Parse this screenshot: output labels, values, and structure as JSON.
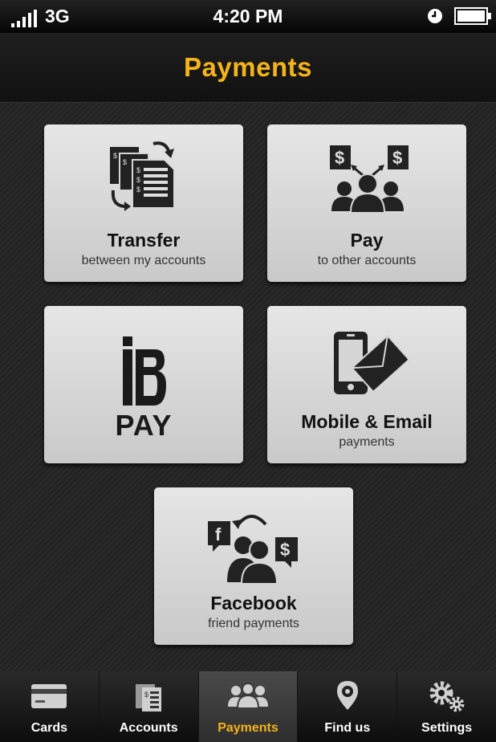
{
  "status_bar": {
    "carrier": "3G",
    "time": "4:20 PM",
    "battery_level": 1.0
  },
  "header": {
    "title": "Payments"
  },
  "tiles": [
    {
      "title": "Transfer",
      "subtitle": "between my accounts",
      "icon": "transfer-documents-icon"
    },
    {
      "title": "Pay",
      "subtitle": "to other accounts",
      "icon": "pay-people-icon"
    },
    {
      "title": "PAY",
      "subtitle": "",
      "icon": "bpay-logo"
    },
    {
      "title": "Mobile & Email",
      "subtitle": "payments",
      "icon": "mobile-email-icon"
    },
    {
      "title": "Facebook",
      "subtitle": "friend payments",
      "icon": "facebook-friends-icon"
    }
  ],
  "tabbar": {
    "active": "Payments",
    "items": [
      {
        "label": "Cards",
        "icon": "card-icon"
      },
      {
        "label": "Accounts",
        "icon": "accounts-icon"
      },
      {
        "label": "Payments",
        "icon": "people-icon"
      },
      {
        "label": "Find us",
        "icon": "location-pin-icon"
      },
      {
        "label": "Settings",
        "icon": "gears-icon"
      }
    ]
  },
  "colors": {
    "accent": "#f5b41a",
    "tile_background": "#d8d8d8",
    "background": "#262626"
  }
}
